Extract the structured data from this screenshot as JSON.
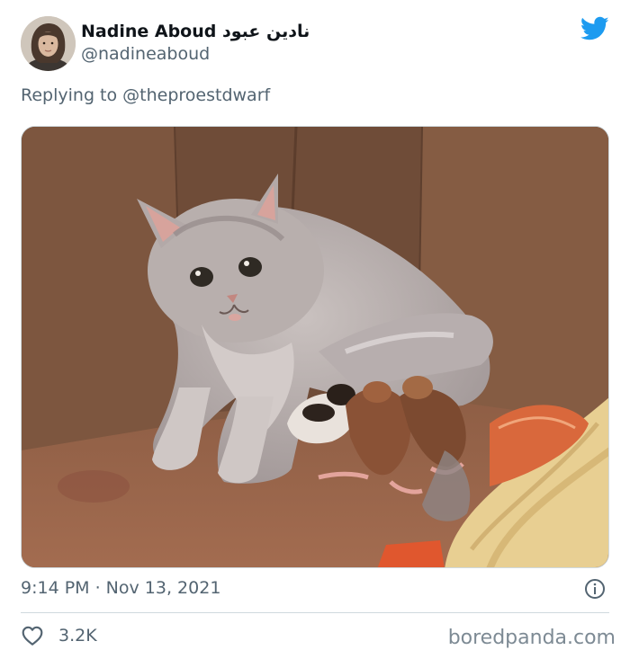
{
  "tweet": {
    "author": {
      "display_name": "Nadine Aboud نادين عبود",
      "handle": "@nadineaboud"
    },
    "reply_prefix": "Replying to ",
    "reply_to": "@theproestdwarf",
    "media": {
      "alt": "Grey long-haired cat nursing newborn kittens in a cardboard box"
    },
    "timestamp": "9:14 PM · Nov 13, 2021",
    "likes": "3.2K"
  },
  "watermark": "boredpanda.com",
  "colors": {
    "twitter_blue": "#1d9bf0",
    "secondary_text": "#536471",
    "border": "#cfd9de"
  },
  "icons": {
    "brand": "twitter-bird-icon",
    "info": "info-icon",
    "like": "heart-icon"
  }
}
